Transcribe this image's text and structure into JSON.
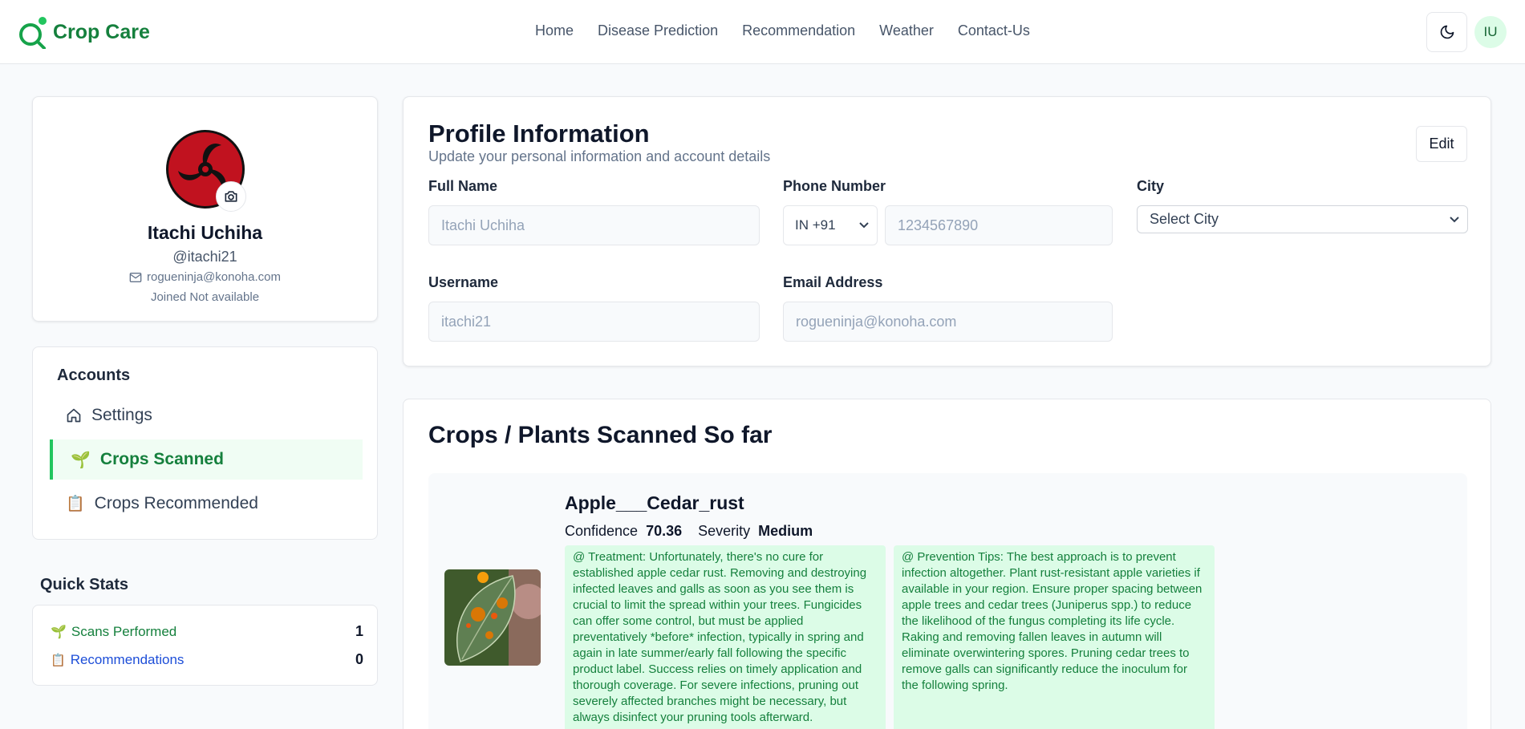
{
  "header": {
    "brand": "Crop Care",
    "nav": [
      "Home",
      "Disease Prediction",
      "Recommendation",
      "Weather",
      "Contact-Us"
    ],
    "avatar_initials": "IU"
  },
  "profile": {
    "name": "Itachi Uchiha",
    "handle": "@itachi21",
    "email": "rogueninja@konoha.com",
    "joined": "Joined Not available"
  },
  "accounts": {
    "title": "Accounts",
    "items": [
      {
        "label": "Settings",
        "icon": "home-icon",
        "active": false
      },
      {
        "label": "Crops Scanned",
        "icon": "seedling-icon",
        "active": true
      },
      {
        "label": "Crops Recommended",
        "icon": "clipboard-icon",
        "active": false
      }
    ]
  },
  "quick_stats": {
    "title": "Quick Stats",
    "scans_label": "Scans Performed",
    "scans_value": "1",
    "recs_label": "Recommendations",
    "recs_value": "0"
  },
  "profile_info": {
    "title": "Profile Information",
    "subtitle": "Update your personal information and account details",
    "edit_label": "Edit",
    "full_name_label": "Full Name",
    "full_name_value": "Itachi Uchiha",
    "phone_label": "Phone Number",
    "country_code": "IN +91",
    "phone_value": "1234567890",
    "city_label": "City",
    "city_value": "Select City",
    "username_label": "Username",
    "username_value": "itachi21",
    "email_label": "Email Address",
    "email_value": "rogueninja@konoha.com"
  },
  "crops_scanned": {
    "title": "Crops / Plants Scanned So far",
    "items": [
      {
        "name": "Apple___Cedar_rust",
        "confidence_label": "Confidence",
        "confidence": "70.36",
        "severity_label": "Severity",
        "severity": "Medium",
        "treatment": "@ Treatment: Unfortunately, there's no cure for established apple cedar rust. Removing and destroying infected leaves and galls as soon as you see them is crucial to limit the spread within your trees. Fungicides can offer some control, but must be applied preventatively *before* infection, typically in spring and again in late summer/early fall following the specific product label. Success relies on timely application and thorough coverage. For severe infections, pruning out severely affected branches might be necessary, but always disinfect your pruning tools afterward.",
        "prevention": "@ Prevention Tips: The best approach is to prevent infection altogether. Plant rust-resistant apple varieties if available in your region. Ensure proper spacing between apple trees and cedar trees (Juniperus spp.) to reduce the likelihood of the fungus completing its life cycle. Raking and removing fallen leaves in autumn will eliminate overwintering spores. Pruning cedar trees to remove galls can significantly reduce the inoculum for the following spring."
      }
    ]
  },
  "colors": {
    "brand_green": "#15803d",
    "active_green_bg": "#f0fdf4",
    "tip_bg": "#dcfce7",
    "link_blue": "#1d4ed8"
  }
}
